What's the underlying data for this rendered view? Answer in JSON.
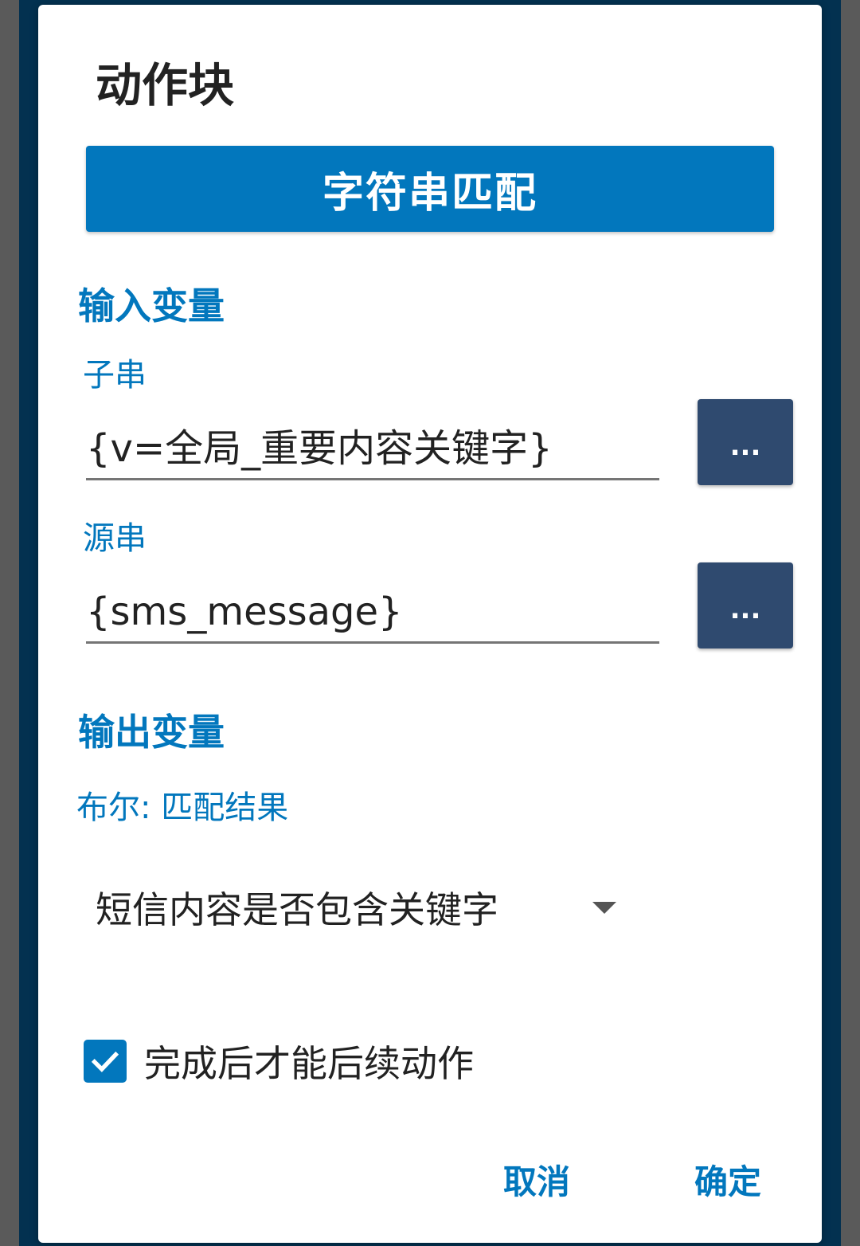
{
  "dialog": {
    "title": "动作块",
    "action_button": "字符串匹配",
    "input_section": {
      "title": "输入变量",
      "fields": [
        {
          "label": "子串",
          "value": "{v=全局_重要内容关键字}",
          "picker": "..."
        },
        {
          "label": "源串",
          "value": "{sms_message}",
          "picker": "..."
        }
      ]
    },
    "output_section": {
      "title": "输出变量",
      "result_label": "布尔: 匹配结果",
      "selected_variable": "短信内容是否包含关键字"
    },
    "checkbox": {
      "label": "完成后才能后续动作",
      "checked": true
    },
    "buttons": {
      "cancel": "取消",
      "confirm": "确定"
    }
  },
  "colors": {
    "accent": "#0277bd",
    "picker_button": "#2f4a6f",
    "backdrop": "#033150"
  }
}
